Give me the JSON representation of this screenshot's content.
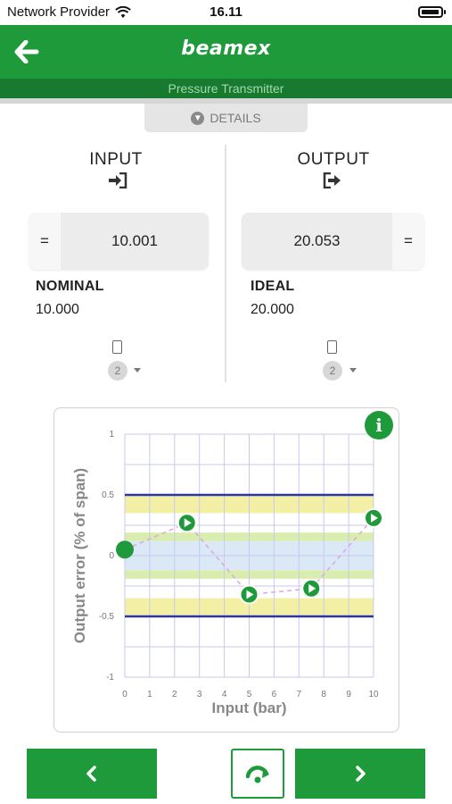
{
  "status_bar": {
    "carrier": "Network Provider",
    "time": "16.11"
  },
  "header": {
    "brand": "beamex",
    "subtitle": "Pressure Transmitter"
  },
  "details_tab": {
    "label": "DETAILS"
  },
  "input": {
    "title": "INPUT",
    "eq_symbol": "=",
    "value": "10.001",
    "nominal_label": "NOMINAL",
    "nominal_value": "10.000",
    "device_count": "2"
  },
  "output": {
    "title": "OUTPUT",
    "eq_symbol": "=",
    "value": "20.053",
    "ideal_label": "IDEAL",
    "ideal_value": "20.000",
    "device_count": "2"
  },
  "chart_data": {
    "type": "scatter",
    "xlabel": "Input (bar)",
    "ylabel": "Output error (% of span)",
    "xlim": [
      0,
      10
    ],
    "ylim": [
      -1,
      1
    ],
    "x_ticks": [
      "0",
      "1",
      "2",
      "3",
      "4",
      "5",
      "6",
      "7",
      "8",
      "9",
      "10"
    ],
    "y_ticks": [
      "1",
      "0.5",
      "0",
      "-0.5",
      "-1"
    ],
    "x_tick_values": [
      0,
      1,
      2,
      3,
      4,
      5,
      6,
      7,
      8,
      9,
      10
    ],
    "y_tick_values": [
      1,
      0.5,
      0,
      -0.5,
      -1
    ],
    "limit_lines": [
      0.5,
      -0.5
    ],
    "warning_bands": [
      [
        0.35,
        0.5
      ],
      [
        -0.5,
        -0.35
      ]
    ],
    "inner_bands": [
      [
        0.12,
        0.19
      ],
      [
        -0.19,
        -0.12
      ]
    ],
    "center_band": [
      -0.12,
      0.12
    ],
    "points": [
      {
        "x": 0,
        "y": 0.05,
        "kind": "current"
      },
      {
        "x": 2.5,
        "y": 0.27,
        "kind": "recorded"
      },
      {
        "x": 5,
        "y": -0.32,
        "kind": "recorded"
      },
      {
        "x": 7.5,
        "y": -0.27,
        "kind": "recorded"
      },
      {
        "x": 10,
        "y": 0.31,
        "kind": "recorded"
      }
    ],
    "colors": {
      "limit": "#2a35a8",
      "warning": "#f3f0a6",
      "inner": "#d9edae",
      "center": "#dbe9f6",
      "grid": "#c8c8ef",
      "point": "#1f9a3a",
      "connector": "#d9a7e6"
    }
  },
  "colors": {
    "accent": "#1f9a3a",
    "accent_dark": "#177a2e"
  },
  "nav": {
    "prev_icon": "chevron-left-icon",
    "next_icon": "chevron-right-icon",
    "restart_icon": "redo-icon"
  }
}
